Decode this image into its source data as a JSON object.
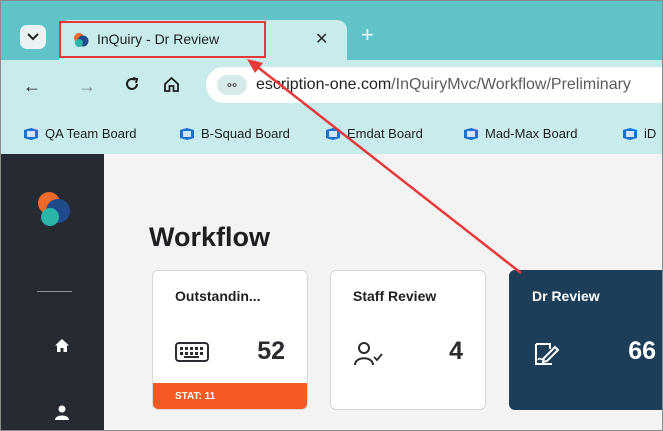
{
  "browser": {
    "tab": {
      "title": "InQuiry - Dr Review",
      "close_glyph": "✕"
    },
    "new_tab_glyph": "+",
    "url_prefix": "escription-one.com",
    "url_path": "/InQuiryMvc/Workflow/Preliminary",
    "bookmarks": [
      {
        "label": "QA Team Board"
      },
      {
        "label": "B-Squad Board"
      },
      {
        "label": "Emdat Board"
      },
      {
        "label": "Mad-Max Board"
      },
      {
        "label": "iD"
      }
    ]
  },
  "page": {
    "title": "Workflow",
    "cards": [
      {
        "title": "Outstandin...",
        "count": "52",
        "icon": "keyboard-icon",
        "footer": "STAT: 11"
      },
      {
        "title": "Staff Review",
        "count": "4",
        "icon": "user-check-icon"
      },
      {
        "title": "Dr Review",
        "count": "66",
        "icon": "signature-icon"
      }
    ]
  },
  "colors": {
    "tabstrip": "#5fc3c8",
    "toolbar": "#c8eceb",
    "rail": "#262b33",
    "active_card": "#1c3e58",
    "stat_footer": "#f55a23",
    "annotation": "#e8393a"
  }
}
